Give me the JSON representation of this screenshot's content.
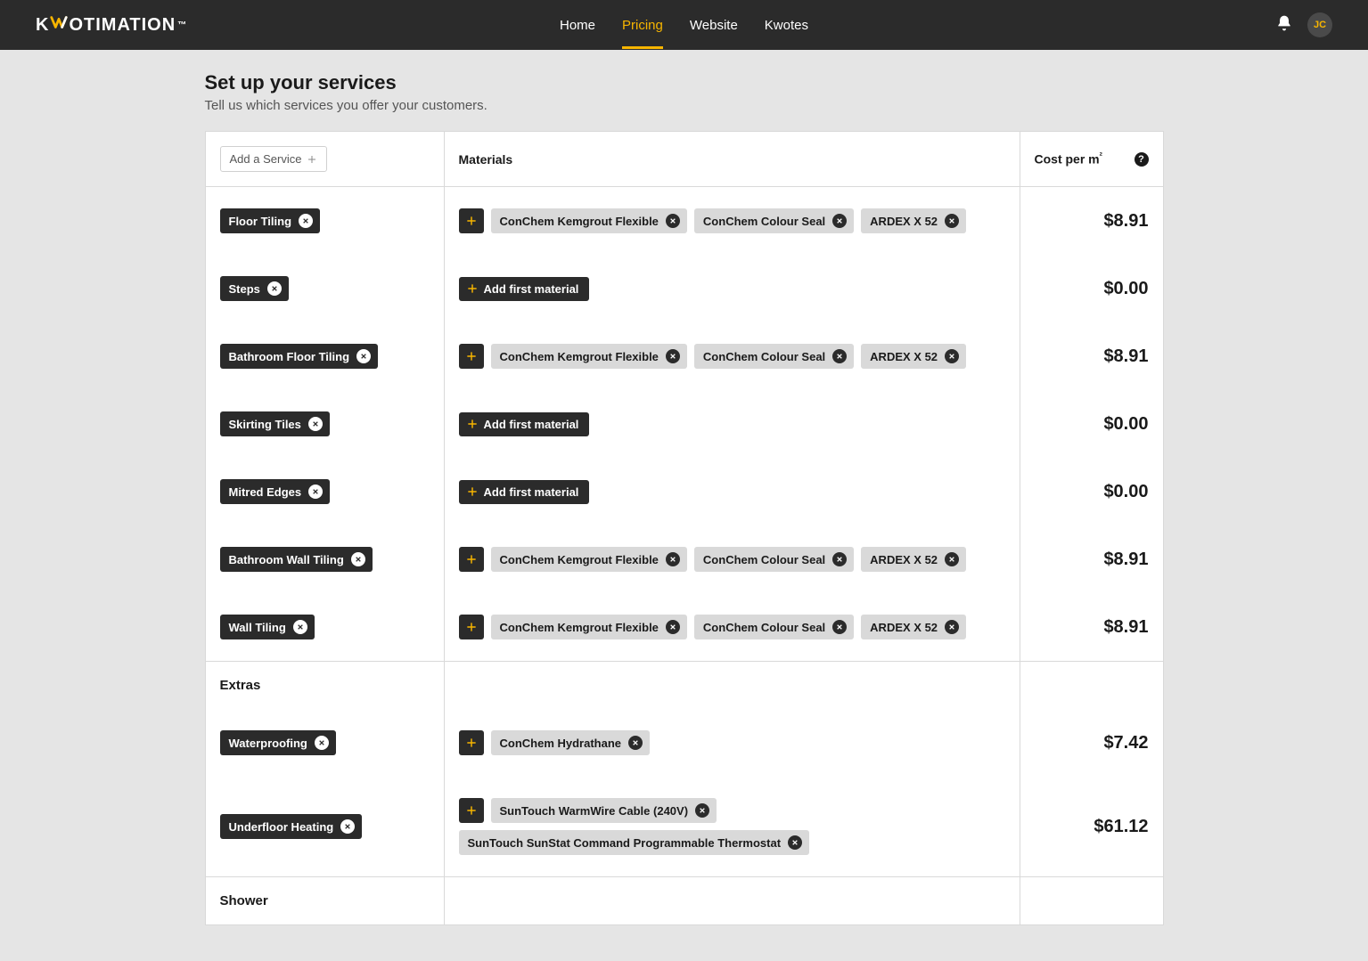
{
  "brand": {
    "part1": "K",
    "accent_svg_label": "W",
    "part3": "OTIMATION",
    "tm": "™"
  },
  "nav": {
    "items": [
      {
        "label": "Home",
        "active": false
      },
      {
        "label": "Pricing",
        "active": true
      },
      {
        "label": "Website",
        "active": false
      },
      {
        "label": "Kwotes",
        "active": false
      }
    ]
  },
  "user": {
    "initials": "JC"
  },
  "page": {
    "title": "Set up your services",
    "subtitle": "Tell us which services you offer your customers."
  },
  "table": {
    "add_service_label": "Add a Service",
    "materials_header": "Materials",
    "cost_header": "Cost per m²",
    "add_first_material_label": "Add first material"
  },
  "rows": [
    {
      "service": "Floor Tiling",
      "materials": [
        "ConChem Kemgrout Flexible",
        "ConChem Colour Seal",
        "ARDEX X 52"
      ],
      "cost": "$8.91"
    },
    {
      "service": "Steps",
      "materials": [],
      "cost": "$0.00"
    },
    {
      "service": "Bathroom Floor Tiling",
      "materials": [
        "ConChem Kemgrout Flexible",
        "ConChem Colour Seal",
        "ARDEX X 52"
      ],
      "cost": "$8.91"
    },
    {
      "service": "Skirting Tiles",
      "materials": [],
      "cost": "$0.00"
    },
    {
      "service": "Mitred Edges",
      "materials": [],
      "cost": "$0.00"
    },
    {
      "service": "Bathroom Wall Tiling",
      "materials": [
        "ConChem Kemgrout Flexible",
        "ConChem Colour Seal",
        "ARDEX X 52"
      ],
      "cost": "$8.91"
    },
    {
      "service": "Wall Tiling",
      "materials": [
        "ConChem Kemgrout Flexible",
        "ConChem Colour Seal",
        "ARDEX X 52"
      ],
      "cost": "$8.91"
    }
  ],
  "sections": {
    "extras": {
      "label": "Extras",
      "rows": [
        {
          "service": "Waterproofing",
          "materials": [
            "ConChem Hydrathane"
          ],
          "cost": "$7.42"
        },
        {
          "service": "Underfloor Heating",
          "materials": [
            "SunTouch WarmWire Cable (240V)",
            "SunTouch SunStat Command Programmable Thermostat"
          ],
          "cost": "$61.12"
        }
      ]
    },
    "shower": {
      "label": "Shower"
    }
  }
}
